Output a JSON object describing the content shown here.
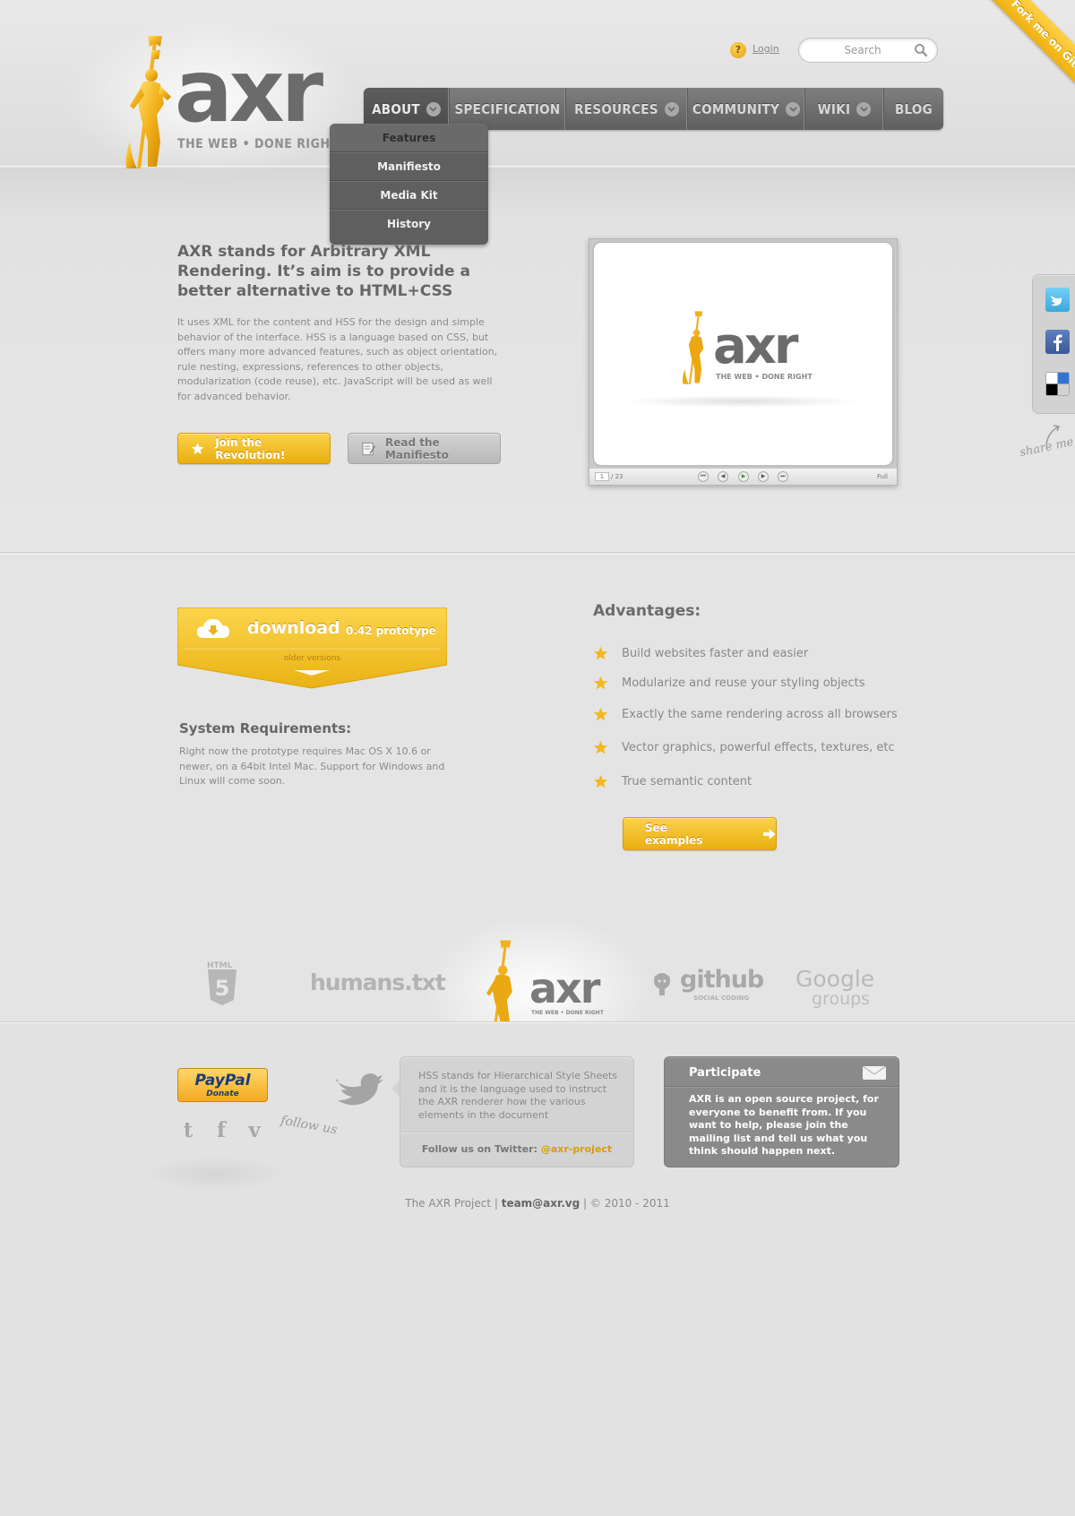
{
  "header": {
    "logo_word": "axr",
    "logo_tagline": "THE WEB  •  DONE RIGHT",
    "login_label": "Login",
    "search_placeholder": "Search",
    "ribbon_label": "Fork me on GitHub"
  },
  "nav": {
    "items": [
      {
        "label": "ABOUT",
        "has_dropdown": true,
        "active": true
      },
      {
        "label": "SPECIFICATION",
        "has_dropdown": false
      },
      {
        "label": "RESOURCES",
        "has_dropdown": true
      },
      {
        "label": "COMMUNITY",
        "has_dropdown": true
      },
      {
        "label": "WIKI",
        "has_dropdown": true
      },
      {
        "label": "BLOG",
        "has_dropdown": false
      }
    ],
    "dropdown": [
      "Features",
      "Manifiesto",
      "Media Kit",
      "History"
    ]
  },
  "hero": {
    "title": "AXR stands for Arbitrary XML Rendering. It’s aim is to provide a better alternative to HTML+CSS",
    "body": "It uses XML for the content and HSS for the design and simple behavior of the interface. HSS  is a language based on CSS, but offers many more advanced features, such as object orientation, rule nesting, expressions, references to other objects, modularization (code reuse), etc. JavaScript will be used as well for advanced behavior.",
    "join_label": "Join the Revolution!",
    "manifesto_label": "Read the Manifiesto"
  },
  "slideshow": {
    "logo_word": "axr",
    "logo_tagline": "THE WEB  •  DONE RIGHT",
    "current_page": "1",
    "total_pages": "/ 23",
    "full_label": "Full"
  },
  "share": {
    "label": "share me",
    "icons": [
      "twitter-icon",
      "facebook-icon",
      "delicious-icon"
    ]
  },
  "download": {
    "label": "download",
    "version": "0.42 prototype",
    "older": "older versions"
  },
  "sysreq": {
    "title": "System Requirements:",
    "body": "Right now the prototype requires Mac OS X 10.6 or newer, on a 64bit Intel Mac. Support for Windows and Linux will come soon."
  },
  "advantages": {
    "title": "Advantages:",
    "items": [
      "Build websites faster and easier",
      "Modularize and reuse your styling objects",
      "Exactly the same rendering across all browsers",
      "Vector graphics, powerful effects, textures, etc",
      "True semantic content"
    ],
    "examples_label": "See examples"
  },
  "partners": {
    "html5": "HTML",
    "humans": "humans.txt",
    "center_logo": "axr",
    "center_tag": "THE WEB  •  DONE RIGHT",
    "github": "github",
    "github_sub": "SOCIAL CODING",
    "google": "Google",
    "google_sub": "groups"
  },
  "footer": {
    "paypal_word": "PayPal",
    "paypal_donate": "Donate",
    "follow_us": "follow us",
    "tweet_text": "HSS stands for Hierarchical Style Sheets and it is the language used to instruct the AXR renderer how the various elements in the document",
    "tweet_follow_prefix": "Follow us on Twitter: ",
    "tweet_handle": "@axr-project",
    "participate_title": "Participate",
    "participate_text": "AXR is an open source project, for everyone to benefit from. If you want to help, please join the mailing list and tell us what you think should happen next.",
    "copyright_prefix": "The AXR Project | ",
    "copyright_email": "team@axr.vg",
    "copyright_suffix": " | © 2010 - 2011"
  },
  "colors": {
    "accent": "#f2b820",
    "nav_bg": "#6e6e6e",
    "page_bg": "#e4e4e4"
  }
}
